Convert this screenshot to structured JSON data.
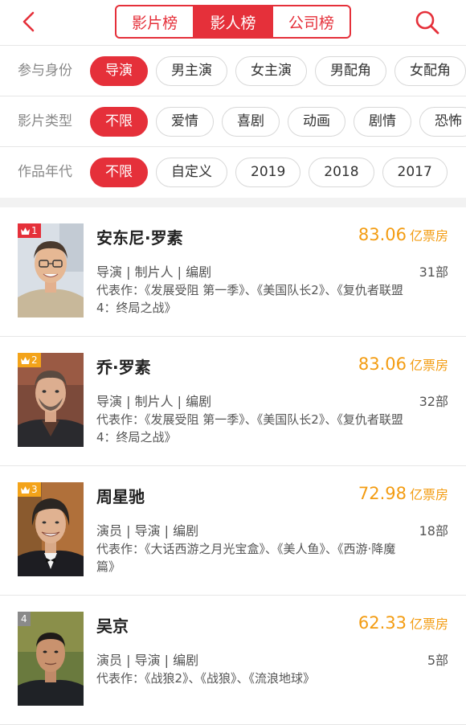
{
  "header": {
    "tabs": [
      {
        "label": "影片榜",
        "active": false
      },
      {
        "label": "影人榜",
        "active": true
      },
      {
        "label": "公司榜",
        "active": false
      }
    ]
  },
  "filters": [
    {
      "label": "参与身份",
      "chips": [
        "导演",
        "男主演",
        "女主演",
        "男配角",
        "女配角"
      ],
      "selected": 0
    },
    {
      "label": "影片类型",
      "chips": [
        "不限",
        "爱情",
        "喜剧",
        "动画",
        "剧情",
        "恐怖"
      ],
      "selected": 0
    },
    {
      "label": "作品年代",
      "chips": [
        "不限",
        "自定义",
        "2019",
        "2018",
        "2017"
      ],
      "selected": 0
    }
  ],
  "ranking": [
    {
      "rank": "1",
      "badge_color": "red",
      "name": "安东尼·罗素",
      "box_office": "83.06",
      "box_unit": "亿票房",
      "roles": "导演 | 制片人 | 编剧",
      "works_count": "31部",
      "works": "代表作：《发展受阻 第一季》、《美国队长2》、《复仇者联盟4：终局之战》"
    },
    {
      "rank": "2",
      "badge_color": "orange",
      "name": "乔·罗素",
      "box_office": "83.06",
      "box_unit": "亿票房",
      "roles": "导演 | 制片人 | 编剧",
      "works_count": "32部",
      "works": "代表作：《发展受阻 第一季》、《美国队长2》、《复仇者联盟4：终局之战》"
    },
    {
      "rank": "3",
      "badge_color": "orange",
      "name": "周星驰",
      "box_office": "72.98",
      "box_unit": "亿票房",
      "roles": "演员 | 导演 | 编剧",
      "works_count": "18部",
      "works": "代表作：《大话西游之月光宝盒》、《美人鱼》、《西游·降魔篇》"
    },
    {
      "rank": "4",
      "badge_color": "gray",
      "name": "吴京",
      "box_office": "62.33",
      "box_unit": "亿票房",
      "roles": "演员 | 导演 | 编剧",
      "works_count": "5部",
      "works": "代表作：《战狼2》、《战狼》、《流浪地球》"
    }
  ],
  "colors": {
    "accent": "#e5303a",
    "box_office": "#f39c12",
    "badge_orange": "#f3a31a",
    "badge_gray": "#8a8a8a"
  },
  "icons": {
    "back": "chevron-left-icon",
    "search": "search-icon",
    "crown": "crown-icon"
  }
}
